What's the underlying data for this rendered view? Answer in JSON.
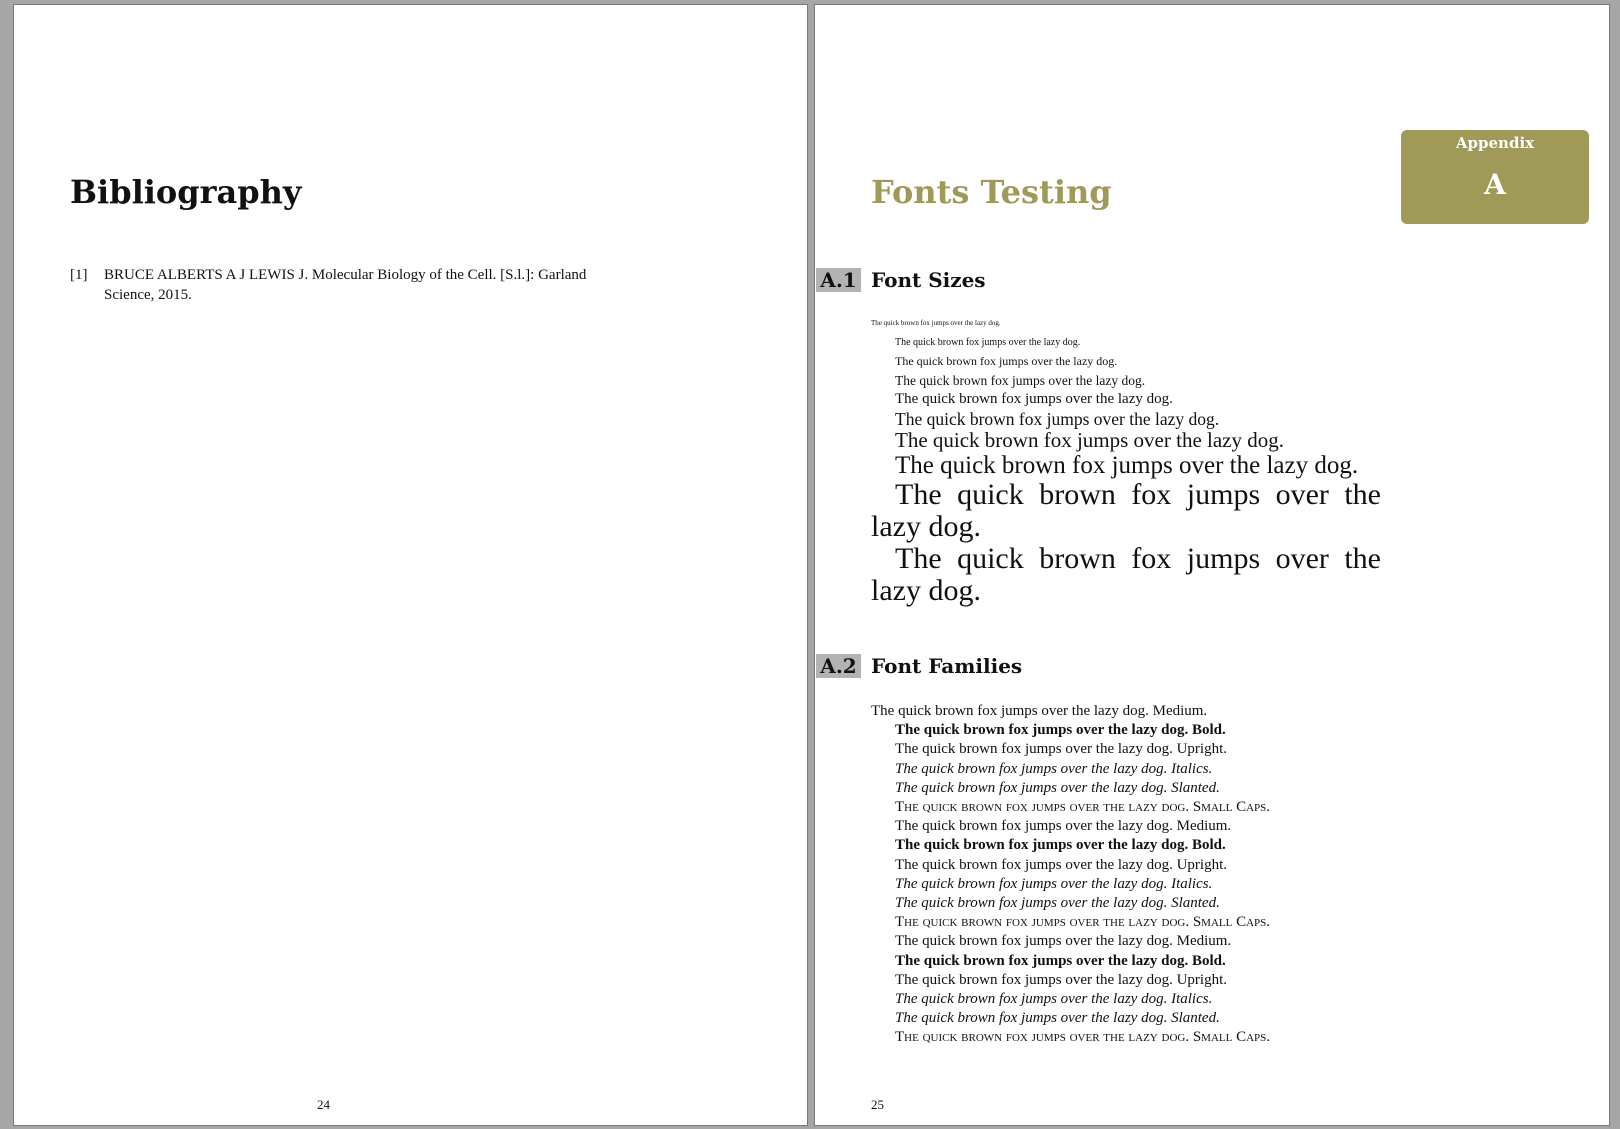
{
  "left_page": {
    "chapter_title": "Bibliography",
    "bibliography": [
      {
        "label": "[1]",
        "text": "BRUCE ALBERTS A J  LEWIS J. Molecular Biology of the Cell. [S.l.]: Garland Science, 2015."
      }
    ],
    "page_number": "24"
  },
  "right_page": {
    "chapter_title": "Fonts Testing",
    "appendix_badge": {
      "label": "Appendix",
      "letter": "A"
    },
    "sections": [
      {
        "number": "A.1",
        "title": "Font Sizes"
      },
      {
        "number": "A.2",
        "title": "Font Families"
      }
    ],
    "font_sizes": [
      "The quick brown fox jumps over the lazy dog.",
      "The quick brown fox jumps over the lazy dog.",
      "The quick brown fox jumps over the lazy dog.",
      "The quick brown fox jumps over the lazy dog.",
      "The quick brown fox jumps over the lazy dog.",
      "The quick brown fox jumps over the lazy dog.",
      "The quick brown fox jumps over the lazy dog.",
      "The quick brown fox jumps over the lazy dog.",
      "The quick brown fox jumps over the lazy dog.",
      "The quick brown fox jumps over the lazy dog."
    ],
    "font_families": [
      "The quick brown fox jumps over the lazy dog. Medium.",
      "The quick brown fox jumps over the lazy dog. Bold.",
      "The quick brown fox jumps over the lazy dog. Upright.",
      "The quick brown fox jumps over the lazy dog. Italics.",
      "The quick brown fox jumps over the lazy dog. Slanted.",
      "The quick brown fox jumps over the lazy dog. Small Caps.",
      "The quick brown fox jumps over the lazy dog. Medium.",
      "The quick brown fox jumps over the lazy dog. Bold.",
      "The quick brown fox jumps over the lazy dog. Upright.",
      "The quick brown fox jumps over the lazy dog. Italics.",
      "The quick brown fox jumps over the lazy dog. Slanted.",
      "The quick brown fox jumps over the lazy dog. Small Caps.",
      "The quick brown fox jumps over the lazy dog. Medium.",
      "The quick brown fox jumps over the lazy dog. Bold.",
      "The quick brown fox jumps over the lazy dog. Upright.",
      "The quick brown fox jumps over the lazy dog. Italics.",
      "The quick brown fox jumps over the lazy dog. Slanted.",
      "The quick brown fox jumps over the lazy dog. Small Caps."
    ],
    "page_number": "25"
  }
}
